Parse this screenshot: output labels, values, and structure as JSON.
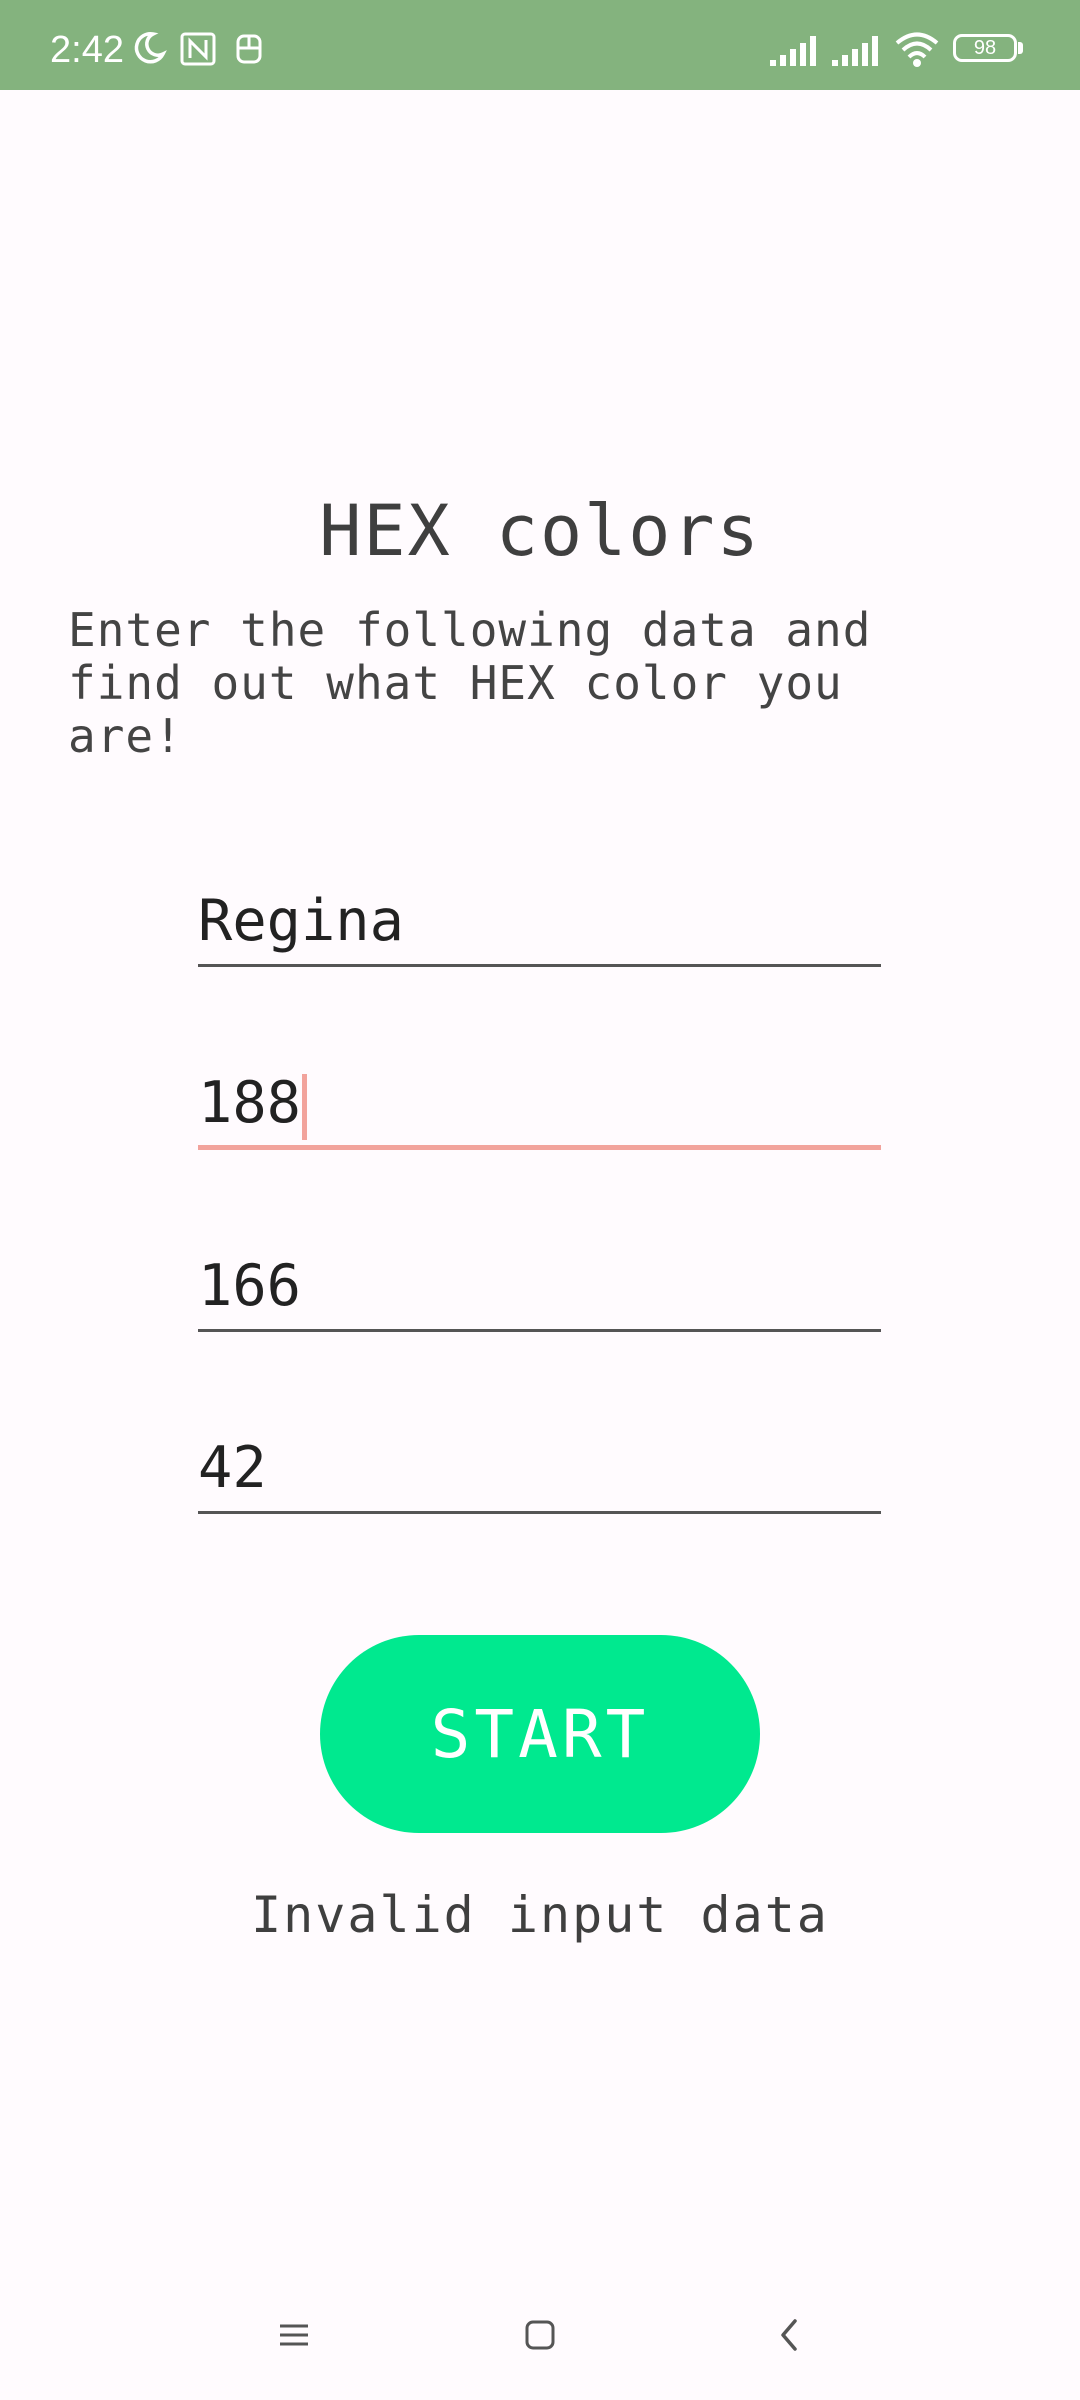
{
  "status_bar": {
    "time": "2:42",
    "battery": "98",
    "icons": [
      "moon-icon",
      "nfc-icon",
      "accessibility-icon",
      "signal-icon",
      "signal-icon",
      "wifi-icon",
      "battery-icon"
    ]
  },
  "app": {
    "title": "HEX colors",
    "subtitle": "Enter the following data and find out what HEX color you are!",
    "fields": {
      "name": "Regina",
      "value_1": "188",
      "value_2": "166",
      "value_3": "42"
    },
    "start_label": "START",
    "message": "Invalid input data"
  },
  "colors": {
    "status_bar": "#84b37e",
    "background": "#fffbfe",
    "accent_button": "#00e98f",
    "focus_underline": "#f2a39c"
  },
  "nav_bar": {
    "icons": [
      "menu-icon",
      "home-icon",
      "back-icon"
    ]
  }
}
